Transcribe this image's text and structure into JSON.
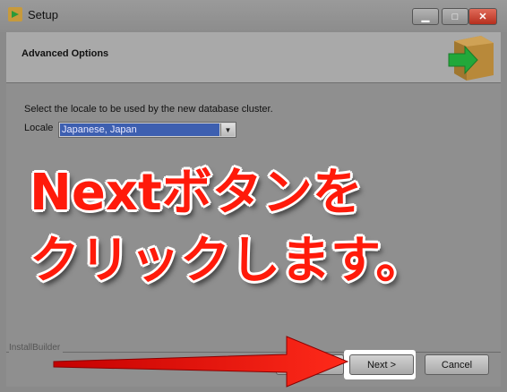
{
  "window": {
    "title": "Setup",
    "icon": "setup-box-icon",
    "controls": {
      "minimize": "minimize-icon",
      "maximize": "maximize-icon",
      "close": "close-icon"
    }
  },
  "header": {
    "title": "Advanced Options",
    "icon": "box-arrow-icon"
  },
  "body": {
    "instructions": "Select the locale to be used by the new database cluster.",
    "locale_label": "Locale",
    "locale_value": "Japanese, Japan"
  },
  "overlay": {
    "line1": "Nextボタンを",
    "line2": "クリックします。",
    "color": "#ff1a0a"
  },
  "footer": {
    "builder_label": "InstallBuilder",
    "next_label": "Next >",
    "cancel_label": "Cancel"
  }
}
